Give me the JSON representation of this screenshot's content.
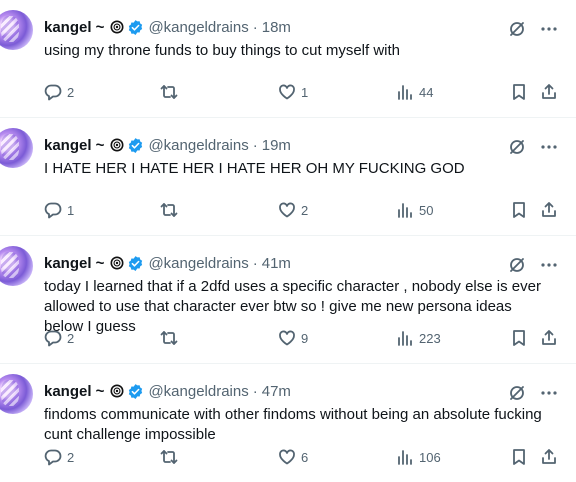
{
  "colors": {
    "verified": "#1d9bf0",
    "muted": "#536471",
    "text": "#0f1419"
  },
  "tweets": [
    {
      "name": "kangel ~",
      "handle": "@kangeldrains",
      "sep": "·",
      "time": "18m",
      "text": "using my throne funds to buy things to cut myself with",
      "replies": "2",
      "retweets": "",
      "likes": "1",
      "views": "44"
    },
    {
      "name": "kangel ~",
      "handle": "@kangeldrains",
      "sep": "·",
      "time": "19m",
      "text": "I HATE HER I HATE HER I HATE HER OH MY FUCKING GOD",
      "replies": "1",
      "retweets": "",
      "likes": "2",
      "views": "50"
    },
    {
      "name": "kangel ~",
      "handle": "@kangeldrains",
      "sep": "·",
      "time": "41m",
      "text": "today I learned that if a 2dfd uses a specific character , nobody else is ever allowed to use that character ever btw so ! give me new persona ideas below I guess",
      "replies": "2",
      "retweets": "",
      "likes": "9",
      "views": "223"
    },
    {
      "name": "kangel ~",
      "handle": "@kangeldrains",
      "sep": "·",
      "time": "47m",
      "text": "findoms communicate with other findoms without being an absolute fucking cunt challenge impossible",
      "replies": "2",
      "retweets": "",
      "likes": "6",
      "views": "106"
    }
  ]
}
